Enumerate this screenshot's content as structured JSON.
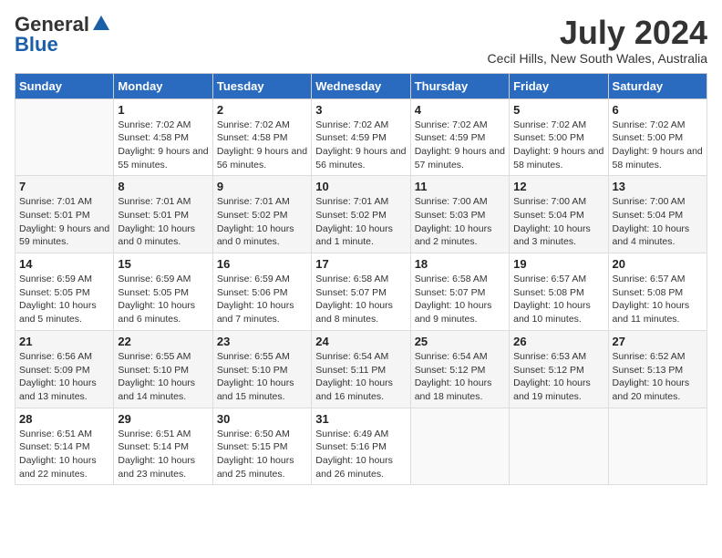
{
  "logo": {
    "general": "General",
    "blue": "Blue"
  },
  "title": "July 2024",
  "location": "Cecil Hills, New South Wales, Australia",
  "weekdays": [
    "Sunday",
    "Monday",
    "Tuesday",
    "Wednesday",
    "Thursday",
    "Friday",
    "Saturday"
  ],
  "weeks": [
    [
      {
        "day": "",
        "sunrise": "",
        "sunset": "",
        "daylight": ""
      },
      {
        "day": "1",
        "sunrise": "Sunrise: 7:02 AM",
        "sunset": "Sunset: 4:58 PM",
        "daylight": "Daylight: 9 hours and 55 minutes."
      },
      {
        "day": "2",
        "sunrise": "Sunrise: 7:02 AM",
        "sunset": "Sunset: 4:58 PM",
        "daylight": "Daylight: 9 hours and 56 minutes."
      },
      {
        "day": "3",
        "sunrise": "Sunrise: 7:02 AM",
        "sunset": "Sunset: 4:59 PM",
        "daylight": "Daylight: 9 hours and 56 minutes."
      },
      {
        "day": "4",
        "sunrise": "Sunrise: 7:02 AM",
        "sunset": "Sunset: 4:59 PM",
        "daylight": "Daylight: 9 hours and 57 minutes."
      },
      {
        "day": "5",
        "sunrise": "Sunrise: 7:02 AM",
        "sunset": "Sunset: 5:00 PM",
        "daylight": "Daylight: 9 hours and 58 minutes."
      },
      {
        "day": "6",
        "sunrise": "Sunrise: 7:02 AM",
        "sunset": "Sunset: 5:00 PM",
        "daylight": "Daylight: 9 hours and 58 minutes."
      }
    ],
    [
      {
        "day": "7",
        "sunrise": "Sunrise: 7:01 AM",
        "sunset": "Sunset: 5:01 PM",
        "daylight": "Daylight: 9 hours and 59 minutes."
      },
      {
        "day": "8",
        "sunrise": "Sunrise: 7:01 AM",
        "sunset": "Sunset: 5:01 PM",
        "daylight": "Daylight: 10 hours and 0 minutes."
      },
      {
        "day": "9",
        "sunrise": "Sunrise: 7:01 AM",
        "sunset": "Sunset: 5:02 PM",
        "daylight": "Daylight: 10 hours and 0 minutes."
      },
      {
        "day": "10",
        "sunrise": "Sunrise: 7:01 AM",
        "sunset": "Sunset: 5:02 PM",
        "daylight": "Daylight: 10 hours and 1 minute."
      },
      {
        "day": "11",
        "sunrise": "Sunrise: 7:00 AM",
        "sunset": "Sunset: 5:03 PM",
        "daylight": "Daylight: 10 hours and 2 minutes."
      },
      {
        "day": "12",
        "sunrise": "Sunrise: 7:00 AM",
        "sunset": "Sunset: 5:04 PM",
        "daylight": "Daylight: 10 hours and 3 minutes."
      },
      {
        "day": "13",
        "sunrise": "Sunrise: 7:00 AM",
        "sunset": "Sunset: 5:04 PM",
        "daylight": "Daylight: 10 hours and 4 minutes."
      }
    ],
    [
      {
        "day": "14",
        "sunrise": "Sunrise: 6:59 AM",
        "sunset": "Sunset: 5:05 PM",
        "daylight": "Daylight: 10 hours and 5 minutes."
      },
      {
        "day": "15",
        "sunrise": "Sunrise: 6:59 AM",
        "sunset": "Sunset: 5:05 PM",
        "daylight": "Daylight: 10 hours and 6 minutes."
      },
      {
        "day": "16",
        "sunrise": "Sunrise: 6:59 AM",
        "sunset": "Sunset: 5:06 PM",
        "daylight": "Daylight: 10 hours and 7 minutes."
      },
      {
        "day": "17",
        "sunrise": "Sunrise: 6:58 AM",
        "sunset": "Sunset: 5:07 PM",
        "daylight": "Daylight: 10 hours and 8 minutes."
      },
      {
        "day": "18",
        "sunrise": "Sunrise: 6:58 AM",
        "sunset": "Sunset: 5:07 PM",
        "daylight": "Daylight: 10 hours and 9 minutes."
      },
      {
        "day": "19",
        "sunrise": "Sunrise: 6:57 AM",
        "sunset": "Sunset: 5:08 PM",
        "daylight": "Daylight: 10 hours and 10 minutes."
      },
      {
        "day": "20",
        "sunrise": "Sunrise: 6:57 AM",
        "sunset": "Sunset: 5:08 PM",
        "daylight": "Daylight: 10 hours and 11 minutes."
      }
    ],
    [
      {
        "day": "21",
        "sunrise": "Sunrise: 6:56 AM",
        "sunset": "Sunset: 5:09 PM",
        "daylight": "Daylight: 10 hours and 13 minutes."
      },
      {
        "day": "22",
        "sunrise": "Sunrise: 6:55 AM",
        "sunset": "Sunset: 5:10 PM",
        "daylight": "Daylight: 10 hours and 14 minutes."
      },
      {
        "day": "23",
        "sunrise": "Sunrise: 6:55 AM",
        "sunset": "Sunset: 5:10 PM",
        "daylight": "Daylight: 10 hours and 15 minutes."
      },
      {
        "day": "24",
        "sunrise": "Sunrise: 6:54 AM",
        "sunset": "Sunset: 5:11 PM",
        "daylight": "Daylight: 10 hours and 16 minutes."
      },
      {
        "day": "25",
        "sunrise": "Sunrise: 6:54 AM",
        "sunset": "Sunset: 5:12 PM",
        "daylight": "Daylight: 10 hours and 18 minutes."
      },
      {
        "day": "26",
        "sunrise": "Sunrise: 6:53 AM",
        "sunset": "Sunset: 5:12 PM",
        "daylight": "Daylight: 10 hours and 19 minutes."
      },
      {
        "day": "27",
        "sunrise": "Sunrise: 6:52 AM",
        "sunset": "Sunset: 5:13 PM",
        "daylight": "Daylight: 10 hours and 20 minutes."
      }
    ],
    [
      {
        "day": "28",
        "sunrise": "Sunrise: 6:51 AM",
        "sunset": "Sunset: 5:14 PM",
        "daylight": "Daylight: 10 hours and 22 minutes."
      },
      {
        "day": "29",
        "sunrise": "Sunrise: 6:51 AM",
        "sunset": "Sunset: 5:14 PM",
        "daylight": "Daylight: 10 hours and 23 minutes."
      },
      {
        "day": "30",
        "sunrise": "Sunrise: 6:50 AM",
        "sunset": "Sunset: 5:15 PM",
        "daylight": "Daylight: 10 hours and 25 minutes."
      },
      {
        "day": "31",
        "sunrise": "Sunrise: 6:49 AM",
        "sunset": "Sunset: 5:16 PM",
        "daylight": "Daylight: 10 hours and 26 minutes."
      },
      {
        "day": "",
        "sunrise": "",
        "sunset": "",
        "daylight": ""
      },
      {
        "day": "",
        "sunrise": "",
        "sunset": "",
        "daylight": ""
      },
      {
        "day": "",
        "sunrise": "",
        "sunset": "",
        "daylight": ""
      }
    ]
  ]
}
